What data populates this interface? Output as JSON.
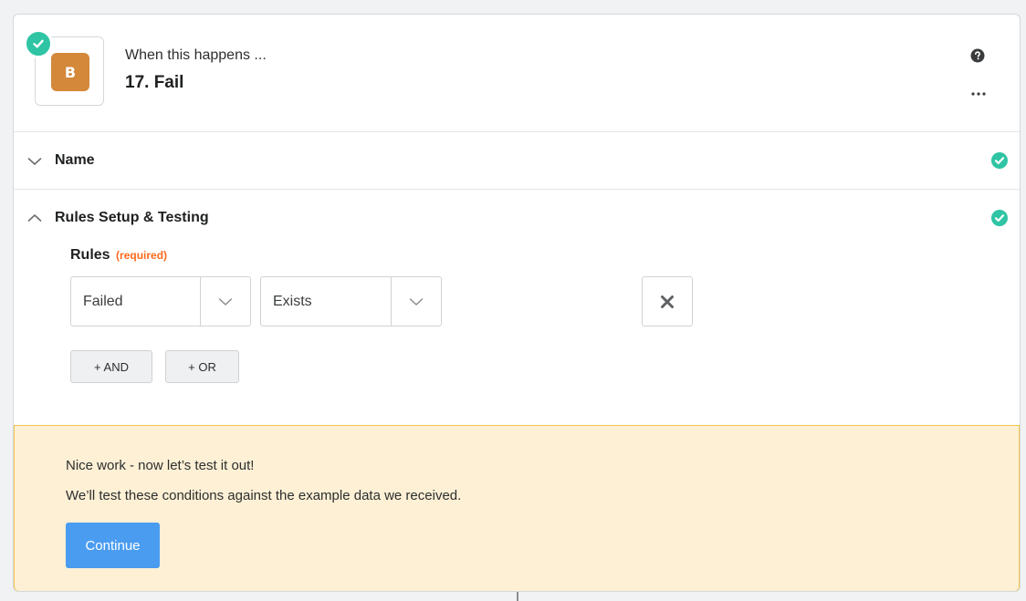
{
  "step": {
    "app_initial": "B",
    "subtitle": "When this happens ...",
    "title": "17. Fail",
    "status": "complete"
  },
  "sections": {
    "name": {
      "label": "Name",
      "expanded": false,
      "status": "complete"
    },
    "rules": {
      "label": "Rules Setup & Testing",
      "expanded": true,
      "status": "complete"
    }
  },
  "rules": {
    "label": "Rules",
    "required_tag": "(required)",
    "field_value": "Failed",
    "operator_value": "Exists",
    "and_button": "+ AND",
    "or_button": "+ OR"
  },
  "test": {
    "line1": "Nice work - now let’s test it out!",
    "line2": "We’ll test these conditions against the example data we received.",
    "continue_button": "Continue"
  },
  "icons": {
    "help": "help-circle-icon",
    "more": "more-horizontal-icon",
    "collapsed": "chevron-down-icon",
    "expanded": "chevron-up-icon",
    "remove": "x-icon",
    "done": "check-circle-icon"
  },
  "colors": {
    "app_icon": "#d3883a",
    "success": "#2fc4a4",
    "primary": "#4a9cf0",
    "banner_bg": "#fdf0d5",
    "banner_border": "#f4c64f",
    "required": "#ff6a1a"
  }
}
